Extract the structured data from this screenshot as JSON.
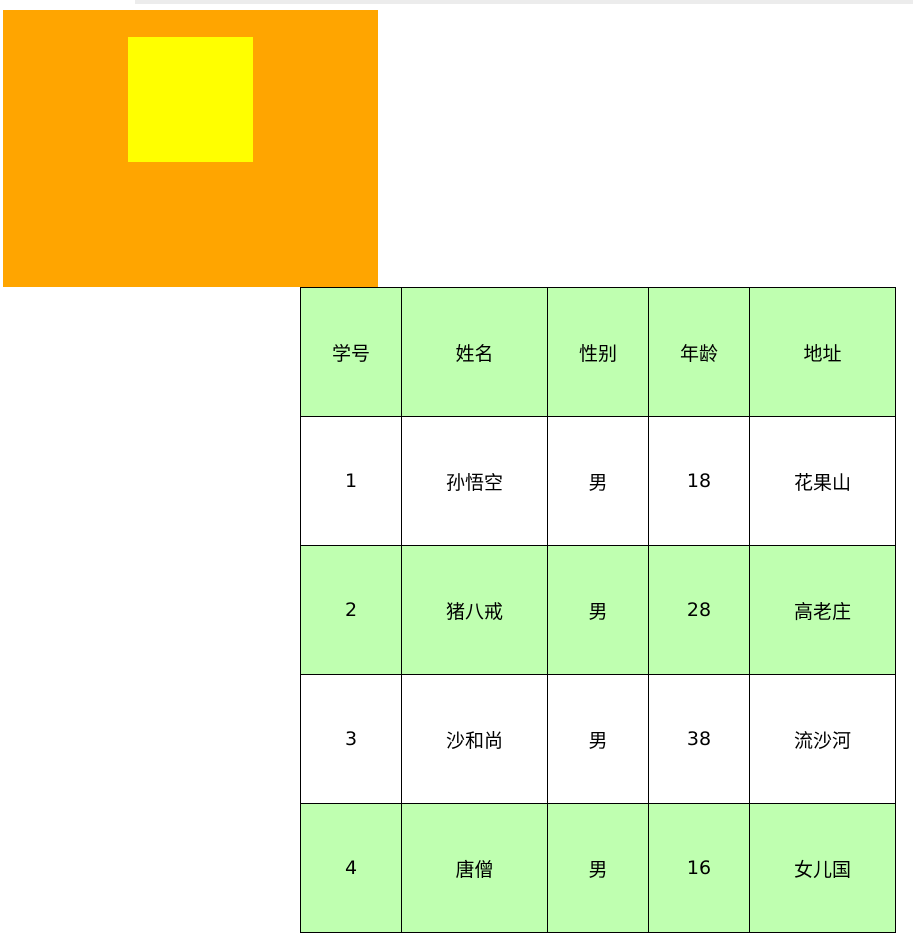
{
  "colors": {
    "outer_box": "#ffa500",
    "inner_box": "#ffff00",
    "row_highlight": "#bfffb0"
  },
  "table": {
    "headers": [
      "学号",
      "姓名",
      "性别",
      "年龄",
      "地址"
    ],
    "rows": [
      [
        "1",
        "孙悟空",
        "男",
        "18",
        "花果山"
      ],
      [
        "2",
        "猪八戒",
        "男",
        "28",
        "高老庄"
      ],
      [
        "3",
        "沙和尚",
        "男",
        "38",
        "流沙河"
      ],
      [
        "4",
        "唐僧",
        "男",
        "16",
        "女儿国"
      ]
    ]
  }
}
